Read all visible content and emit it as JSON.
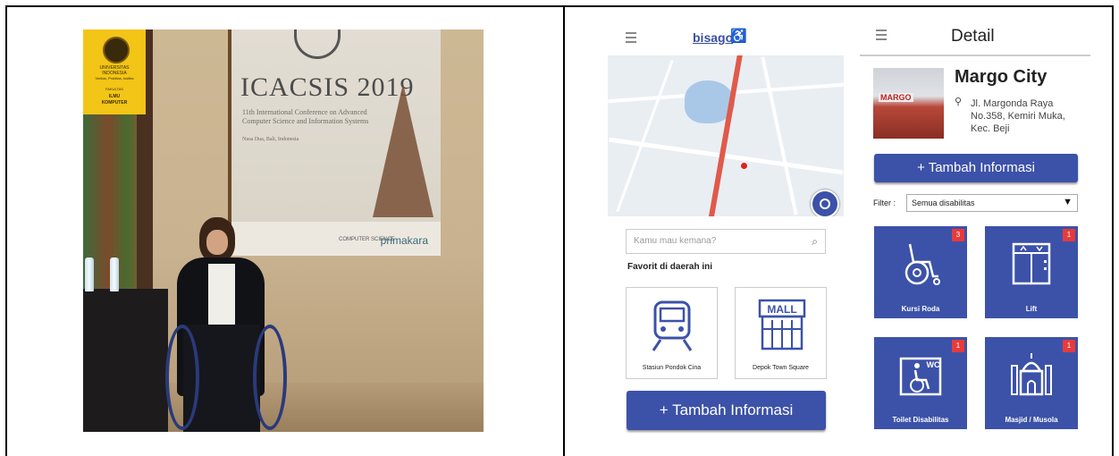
{
  "photo": {
    "logo": {
      "line1": "UNIVERSITAS",
      "line2": "INDONESIA",
      "line3": "Veritas, Probitas, Iustitia",
      "line4": "FAKULTAS",
      "line5": "ILMU",
      "line6": "KOMPUTER"
    },
    "banner": {
      "title": "ICACSIS 2019",
      "subtitle": "11th International Conference on Advanced Computer Science and Information Systems",
      "location": "Nusa Dua, Bali, Indonesia",
      "footer_cs": "COMPUTER SCIENCE",
      "footer_brand": "primakara"
    }
  },
  "app_home": {
    "brand": "bisago",
    "search_placeholder": "Kamu mau kemana?",
    "favorites_title": "Favorit di daerah ini",
    "favorites": [
      {
        "label": "Stasiun Pondok Cina",
        "icon": "train-icon"
      },
      {
        "label": "Depok Town Square",
        "icon": "mall-icon",
        "sign": "MALL"
      }
    ],
    "add_button": "+ Tambah Informasi"
  },
  "app_detail": {
    "title": "Detail",
    "place_name": "Margo City",
    "thumb_sign": "MARGO",
    "address": "Jl. Margonda Raya No.358, Kemiri Muka, Kec. Beji",
    "add_button": "+ Tambah Informasi",
    "filter_label": "Filter :",
    "filter_value": "Semua disabilitas",
    "facilities": [
      {
        "label": "Kursi Roda",
        "count": "3",
        "icon": "wheelchair-icon"
      },
      {
        "label": "Lift",
        "count": "1",
        "icon": "elevator-icon"
      },
      {
        "label": "Toilet Disabilitas",
        "count": "1",
        "icon": "accessible-toilet-icon",
        "sign": "WC"
      },
      {
        "label": "Masjid / Musola",
        "count": "1",
        "icon": "mosque-icon"
      }
    ],
    "colors": {
      "primary": "#3c52a8",
      "badge": "#e83a3a"
    }
  }
}
